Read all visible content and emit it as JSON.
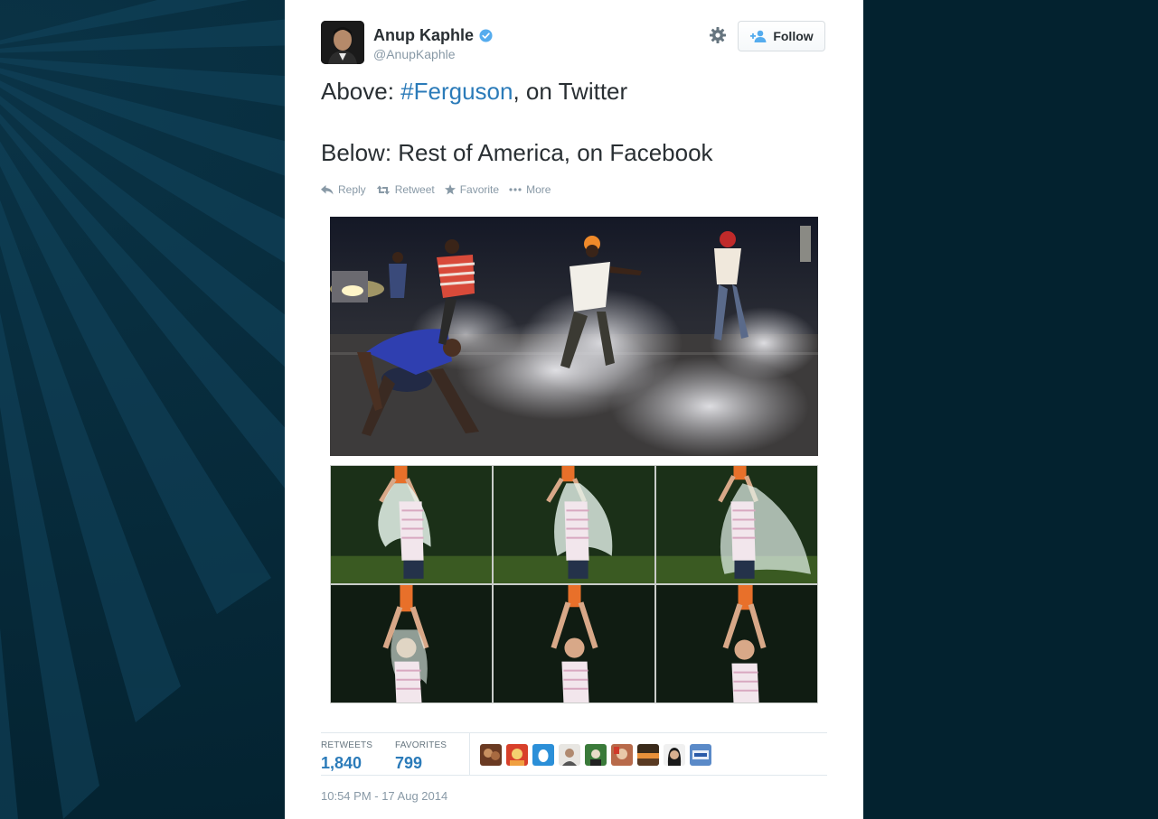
{
  "tweet": {
    "author": {
      "name": "Anup Kaphle",
      "handle": "@AnupKaphle",
      "verified": true
    },
    "follow_label": "Follow",
    "text": {
      "line1_prefix": "Above: ",
      "hashtag": "#Ferguson",
      "line1_suffix": ", on Twitter",
      "line2": "Below: Rest of America, on Facebook"
    },
    "actions": {
      "reply": "Reply",
      "retweet": "Retweet",
      "favorite": "Favorite",
      "more": "More"
    },
    "stats": {
      "retweets_label": "RETWEETS",
      "retweets": "1,840",
      "favorites_label": "FAVORITES",
      "favorites": "799"
    },
    "timestamp": "10:54 PM - 17 Aug 2014"
  },
  "colors": {
    "link": "#2b7bb9",
    "text": "#292f33",
    "muted": "#8899a6",
    "background": "#02222f",
    "verified": "#55acee"
  },
  "icons": [
    "verified-badge-icon",
    "gear-icon",
    "follow-person-icon",
    "reply-icon",
    "retweet-icon",
    "star-icon",
    "more-dots-icon"
  ]
}
